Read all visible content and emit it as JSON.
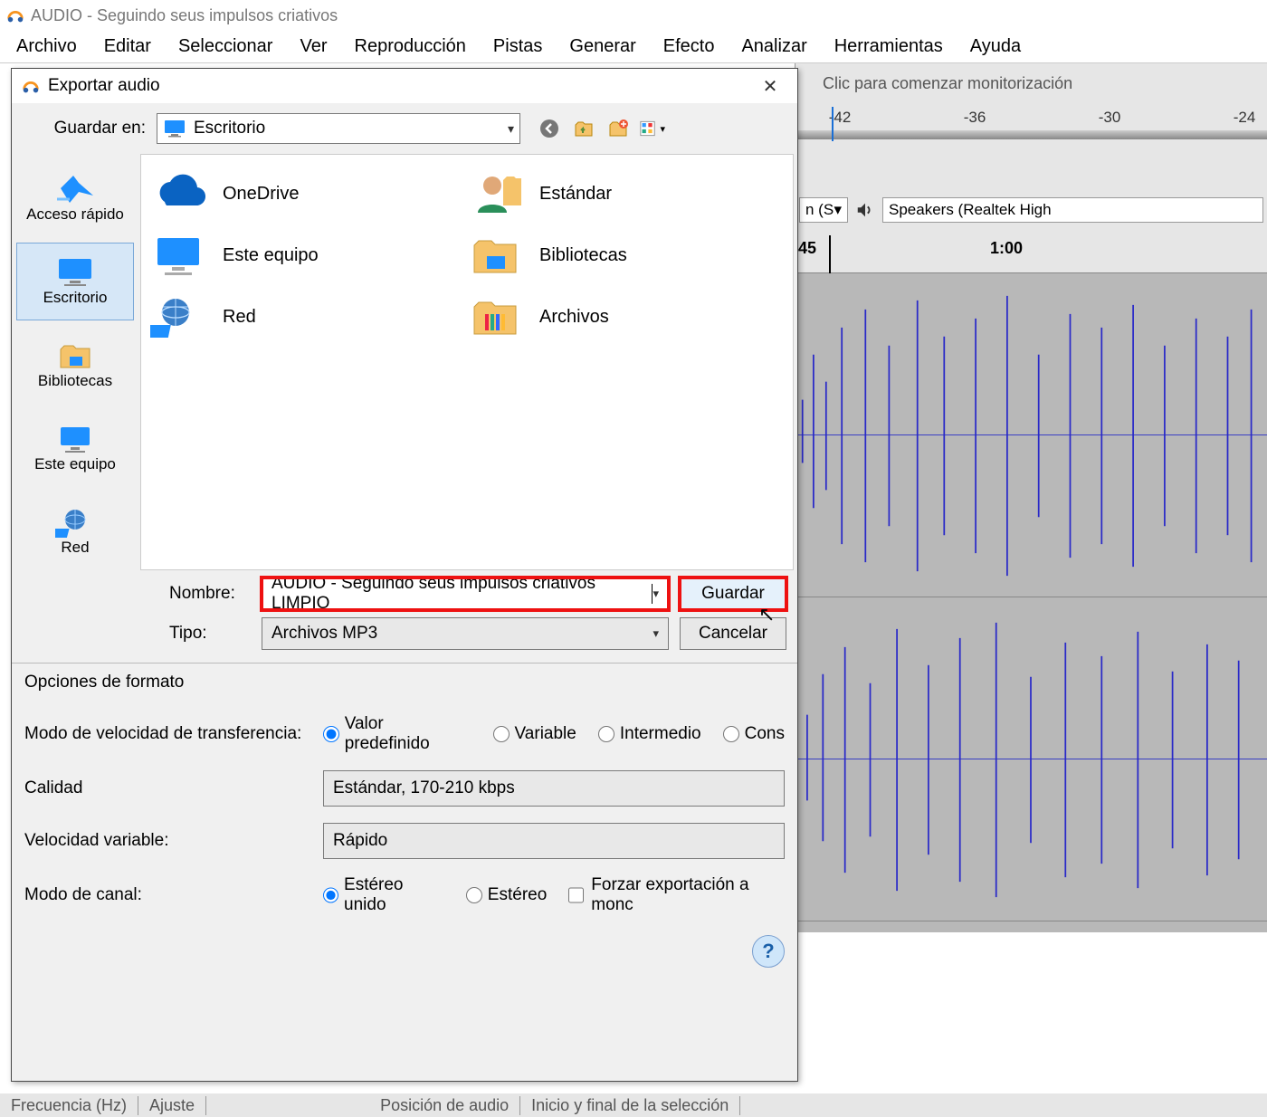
{
  "main_window": {
    "title": "AUDIO - Seguindo seus impulsos criativos"
  },
  "menubar": [
    "Archivo",
    "Editar",
    "Seleccionar",
    "Ver",
    "Reproducción",
    "Pistas",
    "Generar",
    "Efecto",
    "Analizar",
    "Herramientas",
    "Ayuda"
  ],
  "bg": {
    "monitor_text": "Clic para comenzar monitorización",
    "db_ticks": [
      "-42",
      "-36",
      "-30",
      "-24"
    ],
    "output_partial": "n (S",
    "speakers": "Speakers (Realtek High",
    "ruler": {
      "t1": "45",
      "t2": "1:00"
    },
    "status": [
      "Frecuencia (Hz)",
      "Ajuste",
      "Posición de audio",
      "Inicio y final de la selección"
    ]
  },
  "dialog": {
    "title": "Exportar audio",
    "savein_label": "Guardar en:",
    "location": "Escritorio",
    "places": [
      {
        "label": "Acceso rápido"
      },
      {
        "label": "Escritorio"
      },
      {
        "label": "Bibliotecas"
      },
      {
        "label": "Este equipo"
      },
      {
        "label": "Red"
      }
    ],
    "folder_items": [
      {
        "label": "OneDrive"
      },
      {
        "label": "Estándar"
      },
      {
        "label": "Este equipo"
      },
      {
        "label": "Bibliotecas"
      },
      {
        "label": "Red"
      },
      {
        "label": "Archivos"
      }
    ],
    "name_label": "Nombre:",
    "filename": "AUDIO - Seguindo seus impulsos criativos LIMPIO",
    "type_label": "Tipo:",
    "filetype": "Archivos MP3",
    "save_btn": "Guardar",
    "cancel_btn": "Cancelar",
    "format": {
      "legend": "Opciones de formato",
      "bitrate_mode_label": "Modo de velocidad de transferencia:",
      "bitrate_modes": [
        "Valor predefinido",
        "Variable",
        "Intermedio",
        "Cons"
      ],
      "quality_label": "Calidad",
      "quality_value": "Estándar, 170-210 kbps",
      "vbr_label": "Velocidad variable:",
      "vbr_value": "Rápido",
      "channel_label": "Modo de canal:",
      "channel_modes": [
        "Estéreo unido",
        "Estéreo"
      ],
      "force_mono": "Forzar exportación a monc"
    }
  }
}
